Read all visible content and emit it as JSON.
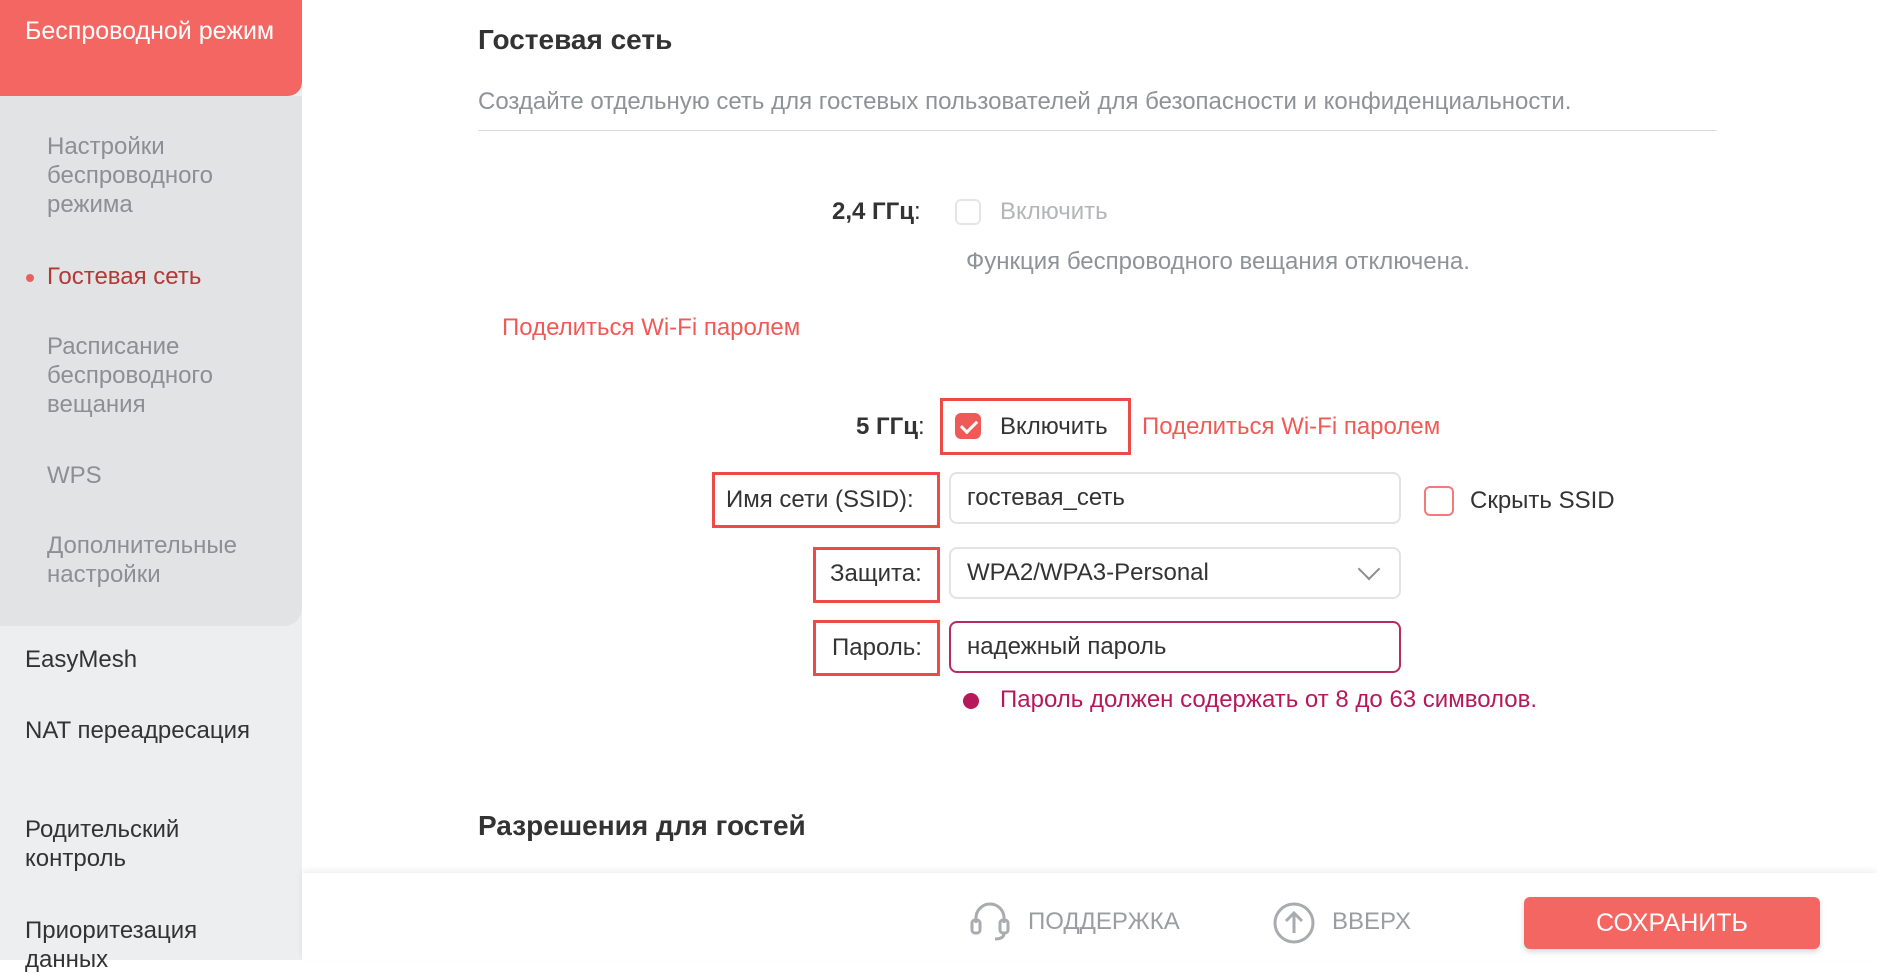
{
  "sidebar": {
    "active": "Беспроводной режим",
    "sub_items": [
      "Настройки беспроводного режима",
      "Гостевая сеть",
      "Расписание беспроводного вещания",
      "WPS",
      "Дополнительные настройки"
    ],
    "items": [
      "EasyMesh",
      "NAT переадресация",
      "Родительский контроль",
      "Приоритезация данных"
    ]
  },
  "guest": {
    "title": "Гостевая сеть",
    "description": "Создайте отдельную сеть для гостевых пользователей для безопасности и конфиденциальности.",
    "band24": {
      "label": "2,4 ГГц",
      "enable_label": "Включить",
      "enabled": false,
      "notice": "Функция беспроводного вещания отключена.",
      "share_link": "Поделиться Wi-Fi паролем"
    },
    "band5": {
      "label": "5 ГГц",
      "enable_label": "Включить",
      "enabled": true,
      "share_link": "Поделиться Wi-Fi паролем"
    },
    "ssid": {
      "label": "Имя сети (SSID):",
      "value": "гостевая_сеть",
      "hide_label": "Скрыть SSID"
    },
    "security": {
      "label": "Защита:",
      "value": "WPA2/WPA3-Personal"
    },
    "password": {
      "label": "Пароль:",
      "value": "надежный пароль",
      "error": "Пароль должен содержать от 8 до 63 символов."
    }
  },
  "permissions": {
    "title": "Разрешения для гостей"
  },
  "footer": {
    "support": "ПОДДЕРЖКА",
    "top": "ВВЕРХ",
    "save": "СОХРАНИТЬ"
  },
  "colors": {
    "accent": "#f46662",
    "error": "#b7185b",
    "highlight": "#ee4b47"
  }
}
